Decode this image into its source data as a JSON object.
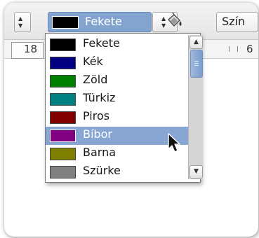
{
  "toolbar": {
    "color_combo": {
      "selected_label": "Fekete",
      "selected_color": "#000000"
    },
    "color_button_label": "Szín"
  },
  "ruler": {
    "left_value": "18",
    "right_value": "6"
  },
  "color_list": {
    "items": [
      {
        "label": "Fekete",
        "color": "#000000"
      },
      {
        "label": "Kék",
        "color": "#000080"
      },
      {
        "label": "Zöld",
        "color": "#008000"
      },
      {
        "label": "Türkiz",
        "color": "#008080"
      },
      {
        "label": "Piros",
        "color": "#800000"
      },
      {
        "label": "Bíbor",
        "color": "#800080"
      },
      {
        "label": "Barna",
        "color": "#808000"
      },
      {
        "label": "Szürke",
        "color": "#808080"
      }
    ],
    "highlighted_label": "Bíbor"
  },
  "accent_color": "#87a6d3",
  "icons": [
    "spin-up-icon",
    "spin-down-icon",
    "fill-bucket-icon",
    "scroll-up-icon",
    "scroll-down-icon",
    "mouse-pointer-icon"
  ]
}
